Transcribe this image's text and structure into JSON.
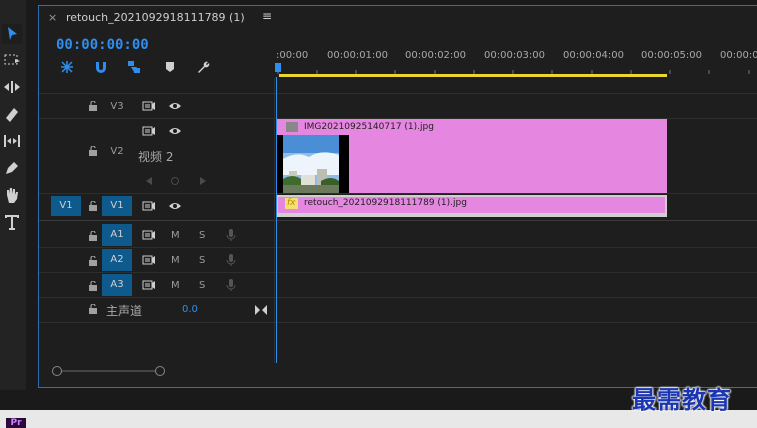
{
  "sequence_tab": {
    "close_symbol": "×",
    "title": "retouch_2021092918111789 (1)",
    "menu_symbol": "≡"
  },
  "playhead_timecode": "00:00:00:00",
  "ruler_labels": [
    ":00:00",
    "00:00:01:00",
    "00:00:02:00",
    "00:00:03:00",
    "00:00:04:00",
    "00:00:05:00",
    "00:00:0("
  ],
  "video_tracks": [
    {
      "label": "V3"
    },
    {
      "label": "V2",
      "name": "视频 2"
    },
    {
      "label": "V1",
      "source_patch": "V1"
    }
  ],
  "audio_tracks": [
    {
      "label": "A1",
      "mute": "M",
      "solo": "S"
    },
    {
      "label": "A2",
      "mute": "M",
      "solo": "S"
    },
    {
      "label": "A3",
      "mute": "M",
      "solo": "S"
    }
  ],
  "master_track": {
    "label": "主声道",
    "value": "0.0"
  },
  "clips": [
    {
      "track": "V2",
      "name": "IMG20210925140717 (1).jpg"
    },
    {
      "track": "V1",
      "name": "retouch_2021092918111789 (1).jpg",
      "fx_label": "fx"
    }
  ],
  "watermark": "最需教育",
  "app_badge": "Pr",
  "colors": {
    "accent_blue": "#2e8ef0",
    "clip_pink": "#e586e0",
    "track_target_blue": "#0f5a8c",
    "work_area_yellow": "#e9d635"
  }
}
